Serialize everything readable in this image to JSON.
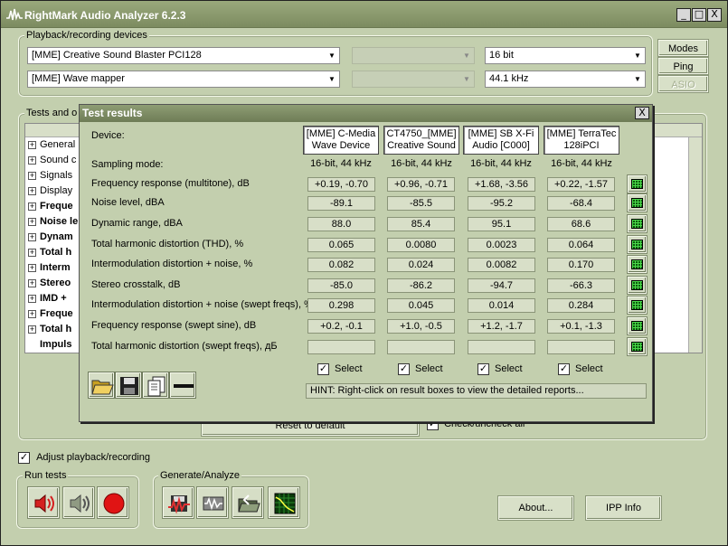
{
  "window": {
    "title": "RightMark Audio Analyzer 6.2.3",
    "minimize": "_",
    "maximize": "□",
    "close": "X"
  },
  "devices_group": {
    "label": "Playback/recording devices",
    "playback_device": "[MME] Creative Sound Blaster PCI128",
    "recording_device": "[MME] Wave mapper",
    "bit_depth": "16 bit",
    "sample_rate": "44.1 kHz"
  },
  "side_buttons": {
    "modes": "Modes",
    "ping": "Ping",
    "asio": "ASIO"
  },
  "tests_group": {
    "label": "Tests and o",
    "items": [
      {
        "label": "General",
        "bold": false,
        "expand": "+"
      },
      {
        "label": "Sound c",
        "bold": false,
        "expand": "+"
      },
      {
        "label": "Signals",
        "bold": false,
        "expand": "+"
      },
      {
        "label": "Display",
        "bold": false,
        "expand": "+"
      },
      {
        "label": "Freque",
        "bold": true,
        "expand": "+"
      },
      {
        "label": "Noise le",
        "bold": true,
        "expand": "+"
      },
      {
        "label": "Dynam",
        "bold": true,
        "expand": "+"
      },
      {
        "label": "Total h",
        "bold": true,
        "expand": "+"
      },
      {
        "label": "Interm",
        "bold": true,
        "expand": "+"
      },
      {
        "label": "Stereo",
        "bold": true,
        "expand": "+"
      },
      {
        "label": "IMD +",
        "bold": true,
        "expand": "+"
      },
      {
        "label": "Freque",
        "bold": true,
        "expand": "+"
      },
      {
        "label": "Total h",
        "bold": true,
        "expand": "+"
      },
      {
        "label": "Impuls",
        "bold": true,
        "expand": ""
      }
    ],
    "reset_button": "Reset to default",
    "check_uncheck_label": "Check/uncheck all",
    "check_mark": "✓"
  },
  "adjust": {
    "label": "Adjust playback/recording",
    "check_mark": "✓"
  },
  "run_tests": {
    "label": "Run tests"
  },
  "generate": {
    "label": "Generate/Analyze"
  },
  "bottom_buttons": {
    "about": "About...",
    "ipp": "IPP Info"
  },
  "dialog": {
    "title": "Test results",
    "close": "X",
    "device_label": "Device:",
    "sampling_label": "Sampling mode:",
    "devices": [
      {
        "line1": "[MME] C-Media",
        "line2": "Wave Device",
        "mode": "16-bit, 44 kHz",
        "select": "Select"
      },
      {
        "line1": "CT4750_[MME]",
        "line2": "Creative Sound",
        "mode": "16-bit, 44 kHz",
        "select": "Select"
      },
      {
        "line1": "[MME] SB X-Fi",
        "line2": "Audio [C000]",
        "mode": "16-bit, 44 kHz",
        "select": "Select"
      },
      {
        "line1": "[MME] TerraTec",
        "line2": "128iPCI",
        "mode": "16-bit, 44 kHz",
        "select": "Select"
      }
    ],
    "select_check": "✓",
    "rows": [
      {
        "label": "Frequency response (multitone), dB",
        "values": [
          "+0.19, -0.70",
          "+0.96, -0.71",
          "+1.68, -3.56",
          "+0.22, -1.57"
        ]
      },
      {
        "label": "Noise level, dBA",
        "values": [
          "-89.1",
          "-85.5",
          "-95.2",
          "-68.4"
        ]
      },
      {
        "label": "Dynamic range, dBA",
        "values": [
          "88.0",
          "85.4",
          "95.1",
          "68.6"
        ]
      },
      {
        "label": "Total harmonic distortion (THD), %",
        "values": [
          "0.065",
          "0.0080",
          "0.0023",
          "0.064"
        ]
      },
      {
        "label": "Intermodulation distortion + noise, %",
        "values": [
          "0.082",
          "0.024",
          "0.0082",
          "0.170"
        ]
      },
      {
        "label": "Stereo crosstalk, dB",
        "values": [
          "-85.0",
          "-86.2",
          "-94.7",
          "-66.3"
        ]
      },
      {
        "label": "Intermodulation distortion + noise (swept freqs), %",
        "values": [
          "0.298",
          "0.045",
          "0.014",
          "0.284"
        ]
      },
      {
        "label": "Frequency response (swept sine), dB",
        "values": [
          "+0.2, -0.1",
          "+1.0, -0.5",
          "+1.2, -1.7",
          "+0.1, -1.3"
        ]
      },
      {
        "label": "Total harmonic distortion (swept freqs), дБ",
        "values": [
          "",
          "",
          "",
          ""
        ]
      }
    ],
    "hint": "HINT: Right-click on result boxes to view the detailed reports..."
  }
}
